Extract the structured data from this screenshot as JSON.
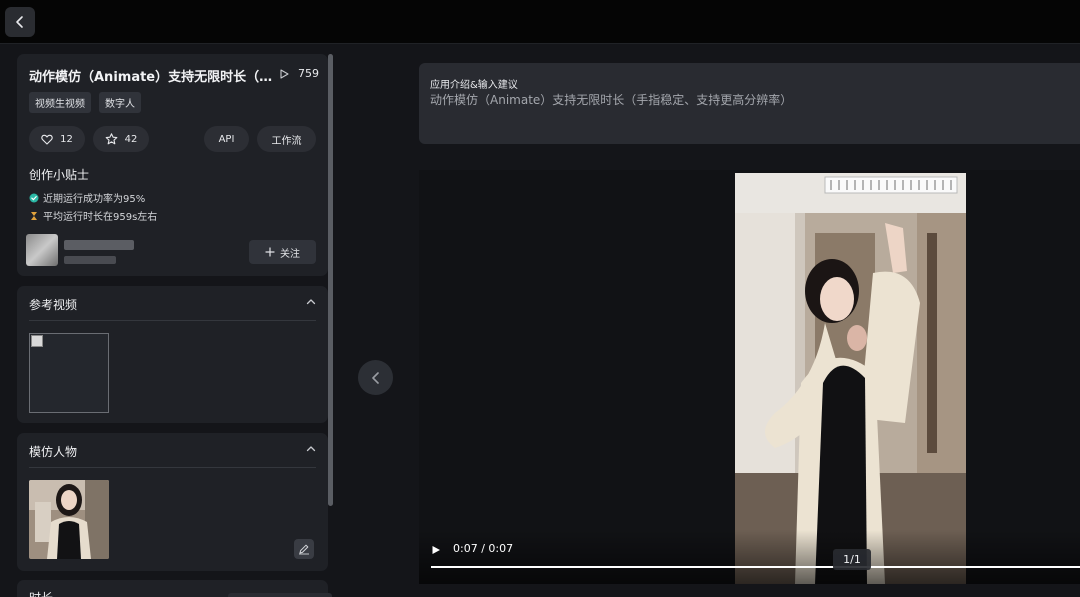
{
  "app": {
    "title": "动作模仿（Animate）支持无限时长（手指稳定、支持更高分辨率）",
    "play_count": "759",
    "tags": [
      "视频生视频",
      "数字人"
    ],
    "likes": "12",
    "favorites": "42",
    "api_label": "API",
    "workflow_label": "工作流"
  },
  "tips": {
    "title": "创作小贴士",
    "items": [
      {
        "icon": "check-circle-icon",
        "text": "近期运行成功率为95%"
      },
      {
        "icon": "hourglass-icon",
        "text": "平均运行时长在959s左右"
      }
    ]
  },
  "author": {
    "follow_label": "关注"
  },
  "reference_video": {
    "title": "参考视频"
  },
  "imitation_character": {
    "title": "模仿人物"
  },
  "duration": {
    "title": "时长"
  },
  "intro": {
    "label": "应用介绍&输入建议",
    "text": "动作模仿（Animate）支持无限时长（手指稳定、支持更高分辨率）"
  },
  "player": {
    "time": "0:07 / 0:07",
    "progress": 1.0,
    "counter": "1/1"
  },
  "colors": {
    "accent_check": "#2bb8a5",
    "accent_hourglass": "#e0a23c"
  }
}
